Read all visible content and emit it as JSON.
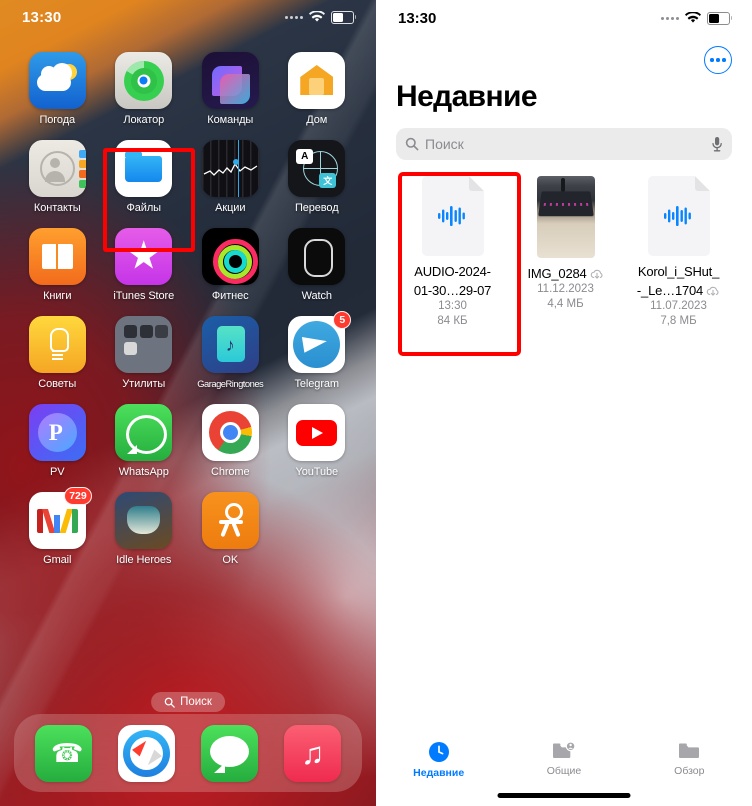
{
  "home": {
    "status": {
      "time": "13:30",
      "wifi_icon": "wifi-icon",
      "battery_icon": "battery-icon",
      "signal_icon": "signal-dots-icon"
    },
    "apps": [
      [
        {
          "label": "Погода",
          "icon": "weather-app-icon",
          "badge": null
        },
        {
          "label": "Локатор",
          "icon": "find-my-app-icon",
          "badge": null
        },
        {
          "label": "Команды",
          "icon": "shortcuts-app-icon",
          "badge": null
        },
        {
          "label": "Дом",
          "icon": "home-app-icon",
          "badge": null
        }
      ],
      [
        {
          "label": "Контакты",
          "icon": "contacts-app-icon",
          "badge": null
        },
        {
          "label": "Файлы",
          "icon": "files-app-icon",
          "badge": null
        },
        {
          "label": "Акции",
          "icon": "stocks-app-icon",
          "badge": null
        },
        {
          "label": "Перевод",
          "icon": "translate-app-icon",
          "badge": null
        }
      ],
      [
        {
          "label": "Книги",
          "icon": "books-app-icon",
          "badge": null
        },
        {
          "label": "iTunes Store",
          "icon": "itunes-app-icon",
          "badge": null
        },
        {
          "label": "Фитнес",
          "icon": "fitness-app-icon",
          "badge": null
        },
        {
          "label": "Watch",
          "icon": "watch-app-icon",
          "badge": null
        }
      ],
      [
        {
          "label": "Советы",
          "icon": "tips-app-icon",
          "badge": null
        },
        {
          "label": "Утилиты",
          "icon": "utilities-folder-icon",
          "badge": null
        },
        {
          "label": "GarageRingtones",
          "icon": "garageringtones-app-icon",
          "badge": null
        },
        {
          "label": "Telegram",
          "icon": "telegram-app-icon",
          "badge": "5"
        }
      ],
      [
        {
          "label": "PV",
          "icon": "pv-app-icon",
          "badge": null
        },
        {
          "label": "WhatsApp",
          "icon": "whatsapp-app-icon",
          "badge": null
        },
        {
          "label": "Chrome",
          "icon": "chrome-app-icon",
          "badge": null
        },
        {
          "label": "YouTube",
          "icon": "youtube-app-icon",
          "badge": null
        }
      ],
      [
        {
          "label": "Gmail",
          "icon": "gmail-app-icon",
          "badge": "729"
        },
        {
          "label": "Idle Heroes",
          "icon": "idle-heroes-app-icon",
          "badge": null
        },
        {
          "label": "OK",
          "icon": "ok-app-icon",
          "badge": null
        }
      ]
    ],
    "search_pill": {
      "label": "Поиск",
      "icon": "search-icon"
    },
    "dock": [
      {
        "label": "Телефон",
        "icon": "phone-app-icon"
      },
      {
        "label": "Safari",
        "icon": "safari-app-icon"
      },
      {
        "label": "Сообщения",
        "icon": "messages-app-icon"
      },
      {
        "label": "Музыка",
        "icon": "music-app-icon"
      }
    ],
    "highlight": {
      "target": "Файлы",
      "color": "#ff0000"
    }
  },
  "files": {
    "status": {
      "time": "13:30",
      "wifi_icon": "wifi-icon",
      "battery_icon": "battery-icon",
      "signal_icon": "signal-dots-icon"
    },
    "more_button": {
      "icon": "more-circle-icon"
    },
    "title": "Недавние",
    "search": {
      "placeholder": "Поиск",
      "icon": "search-icon",
      "mic_icon": "microphone-icon"
    },
    "items": [
      {
        "name_line1": "AUDIO-2024-",
        "name_line2": "01-30…29-07",
        "meta_line1": "13:30",
        "meta_line2": "84 КБ",
        "icon": "audio-waveform-file-icon",
        "cloud_icon": null,
        "selected": true
      },
      {
        "name_line1": "IMG_0284",
        "name_line2": "",
        "meta_line1": "11.12.2023",
        "meta_line2": "4,4 МБ",
        "icon": "photo-thumbnail",
        "cloud_icon": "icloud-download-icon",
        "selected": false
      },
      {
        "name_line1": "Korol_i_SHut_",
        "name_line2": "-_Le…1704",
        "meta_line1": "11.07.2023",
        "meta_line2": "7,8 МБ",
        "icon": "audio-waveform-file-icon",
        "cloud_icon": "icloud-download-icon",
        "selected": false
      }
    ],
    "tabs": [
      {
        "label": "Недавние",
        "icon": "clock-icon",
        "active": true
      },
      {
        "label": "Общие",
        "icon": "shared-folder-icon",
        "active": false
      },
      {
        "label": "Обзор",
        "icon": "folder-icon",
        "active": false
      }
    ],
    "accent_color": "#007aff",
    "highlight": {
      "target": "AUDIO-2024-01-30…29-07",
      "color": "#ff0000"
    }
  }
}
